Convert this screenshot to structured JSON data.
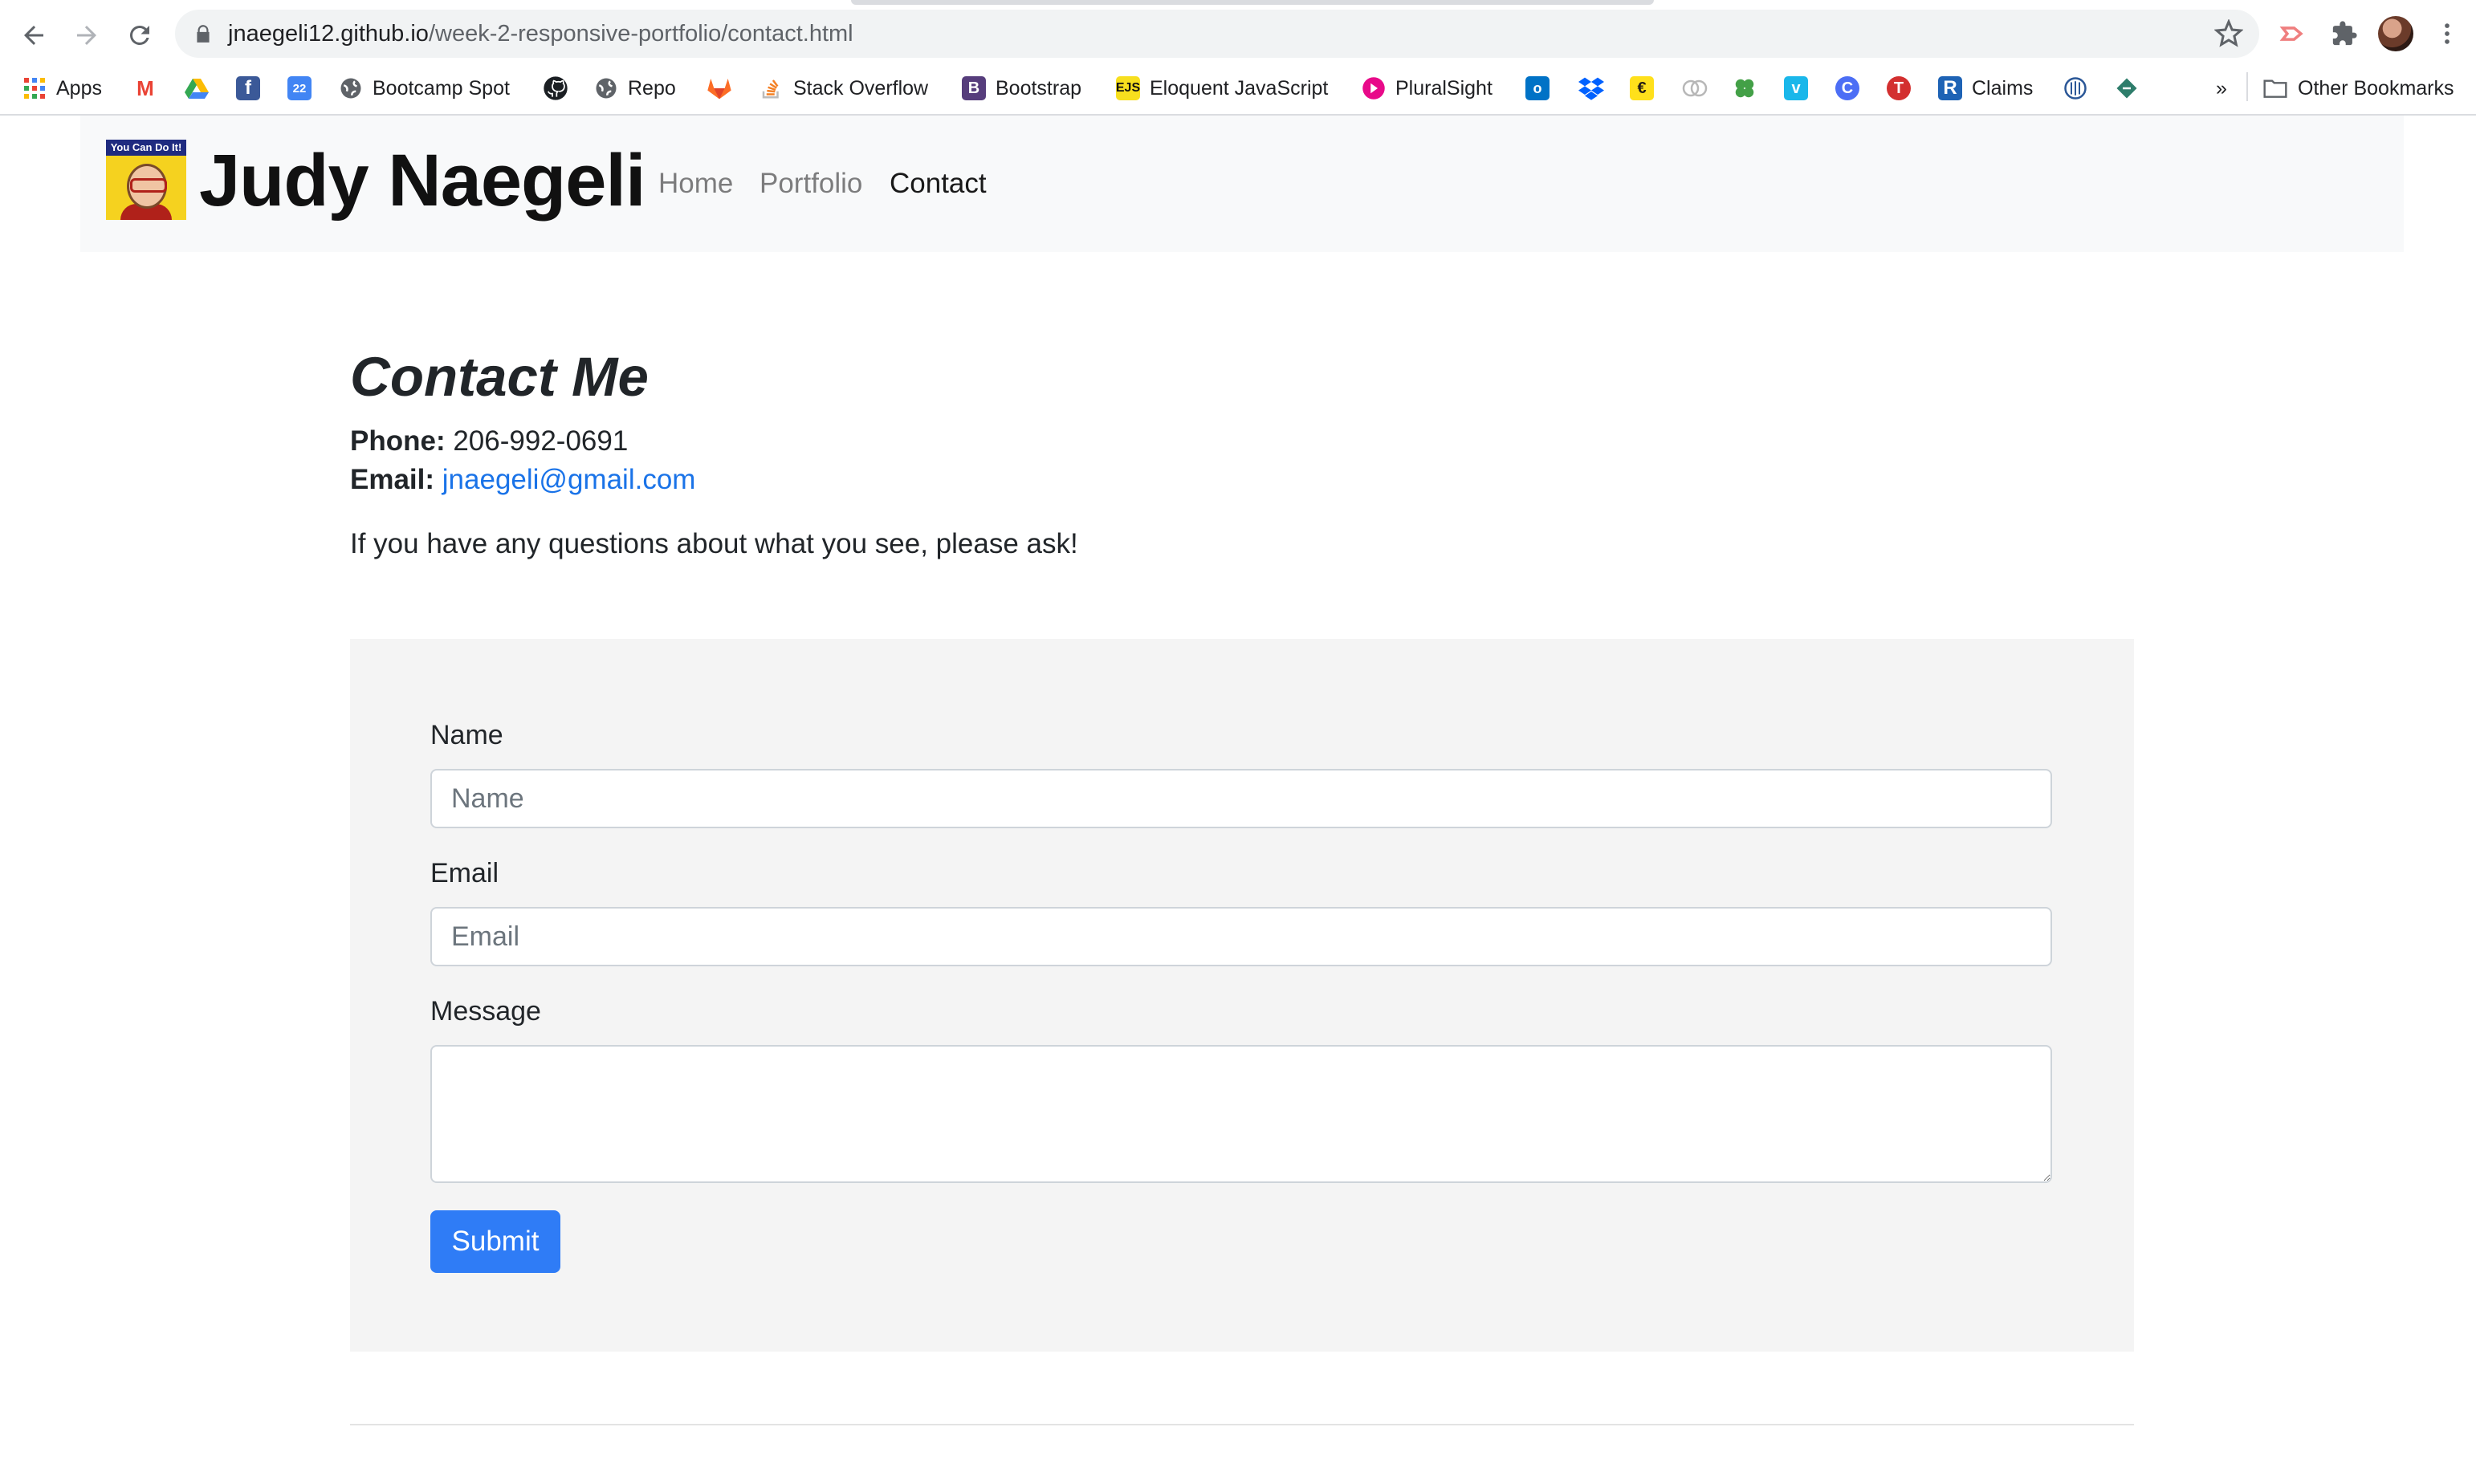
{
  "browser": {
    "url_host": "jnaegeli12.github.io",
    "url_path": "/week-2-responsive-portfolio/contact.html",
    "bookmarks": [
      {
        "label": "Apps",
        "icon": "apps-grid-icon"
      },
      {
        "label": "",
        "icon": "gmail-icon"
      },
      {
        "label": "",
        "icon": "google-drive-icon"
      },
      {
        "label": "",
        "icon": "facebook-icon"
      },
      {
        "label": "",
        "icon": "calendar-icon",
        "badge": "22"
      },
      {
        "label": "Bootcamp Spot",
        "icon": "globe-icon"
      },
      {
        "label": "",
        "icon": "github-icon"
      },
      {
        "label": "Repo",
        "icon": "globe-icon"
      },
      {
        "label": "",
        "icon": "gitlab-icon"
      },
      {
        "label": "Stack Overflow",
        "icon": "stackoverflow-icon"
      },
      {
        "label": "Bootstrap",
        "icon": "bootstrap-icon"
      },
      {
        "label": "Eloquent JavaScript",
        "icon": "ejs-icon"
      },
      {
        "label": "PluralSight",
        "icon": "pluralsight-icon"
      },
      {
        "label": "",
        "icon": "outlook-icon"
      },
      {
        "label": "",
        "icon": "dropbox-icon"
      },
      {
        "label": "",
        "icon": "mailchimp-icon"
      },
      {
        "label": "",
        "icon": "rings-icon"
      },
      {
        "label": "",
        "icon": "clover-icon"
      },
      {
        "label": "",
        "icon": "vimeo-icon"
      },
      {
        "label": "",
        "icon": "c-icon"
      },
      {
        "label": "",
        "icon": "t-icon"
      },
      {
        "label": "Claims",
        "icon": "r-icon"
      },
      {
        "label": "",
        "icon": "seal-icon"
      },
      {
        "label": "",
        "icon": "diamond-icon"
      }
    ],
    "overflow_label": "»",
    "other_bookmarks": "Other Bookmarks"
  },
  "site": {
    "logo_text": "You Can Do It!",
    "brand": "Judy Naegeli",
    "nav": [
      {
        "label": "Home",
        "active": false
      },
      {
        "label": "Portfolio",
        "active": false
      },
      {
        "label": "Contact",
        "active": true
      }
    ]
  },
  "contact": {
    "heading": "Contact Me",
    "phone_label": "Phone:",
    "phone": "206-992-0691",
    "email_label": "Email:",
    "email": "jnaegeli@gmail.com",
    "blurb": "If you have any questions about what you see, please ask!"
  },
  "form": {
    "name_label": "Name",
    "name_placeholder": "Name",
    "email_label": "Email",
    "email_placeholder": "Email",
    "message_label": "Message",
    "submit_label": "Submit"
  },
  "colors": {
    "link": "#1a73e8",
    "submit": "#2f7cf6",
    "navbar_bg": "#f8f9fa",
    "form_bg": "#f4f4f4"
  }
}
